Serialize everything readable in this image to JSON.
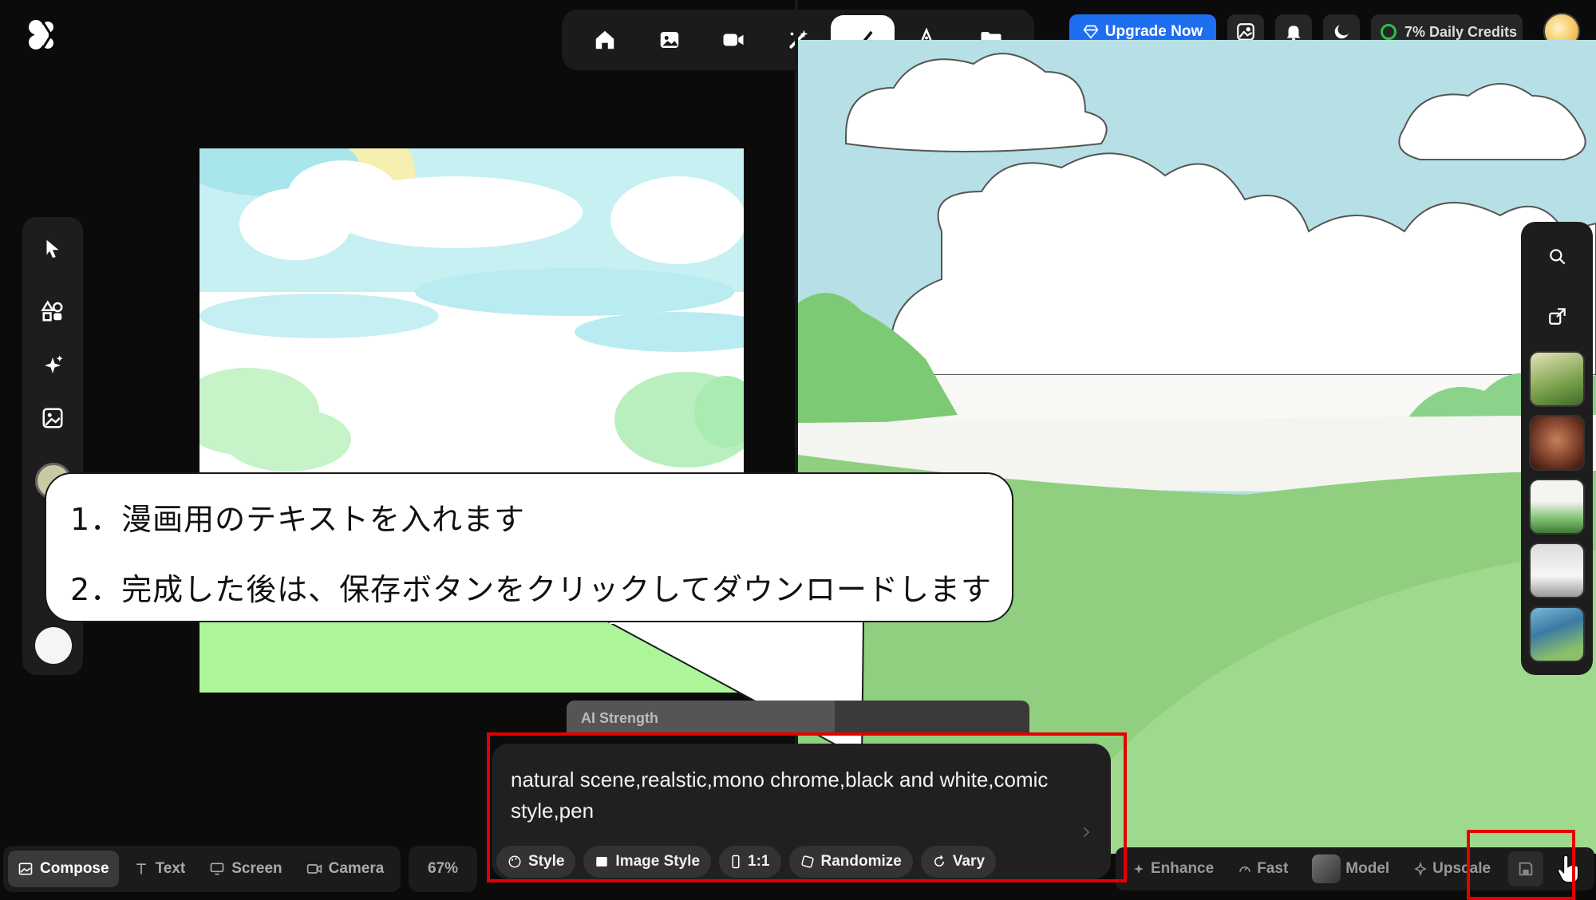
{
  "topbar": {
    "upgrade_label": "Upgrade Now",
    "credits_label": "7% Daily Credits"
  },
  "callout": {
    "line1": "1．漫画用のテキストを入れます",
    "line2": "2．完成した後は、保存ボタンをクリックしてダウンロードします"
  },
  "ai_strength": {
    "label": "AI Strength",
    "value_fraction": 0.58
  },
  "prompt": {
    "value": "natural scene,realstic,mono chrome,black and white,comic style,pen",
    "buttons": {
      "style": "Style",
      "image_style": "Image Style",
      "ratio": "1:1",
      "randomize": "Randomize",
      "vary": "Vary"
    }
  },
  "bottombar": {
    "compose": "Compose",
    "text": "Text",
    "screen": "Screen",
    "camera": "Camera",
    "zoom": "67%",
    "enhance": "Enhance",
    "fast": "Fast",
    "model": "Model",
    "upscale": "Upscale"
  },
  "colors": {
    "accent_blue": "#1e6ef0",
    "highlight_red": "#e50000",
    "credit_green": "#2bc24a"
  },
  "icons": [
    "logo-icon",
    "home-icon",
    "image-icon",
    "video-icon",
    "magic-wand-icon",
    "brush-icon",
    "vector-pen-icon",
    "folder-icon",
    "diamond-icon",
    "gallery-icon",
    "bell-icon",
    "moon-icon",
    "cursor-icon",
    "shapes-icon",
    "sparkle-icon",
    "image-upload-icon",
    "search-icon",
    "export-icon",
    "save-icon",
    "hand-cursor-icon"
  ]
}
